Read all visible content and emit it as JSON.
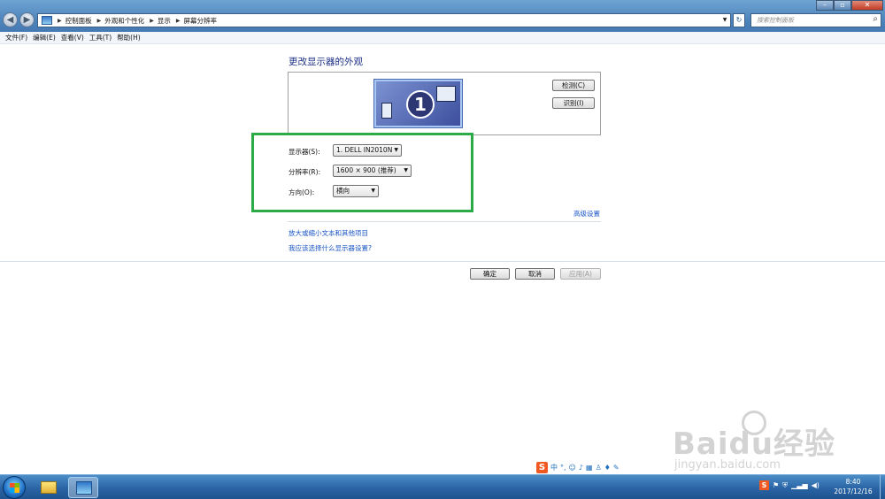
{
  "address_bar": {
    "breadcrumbs": [
      "控制面板",
      "外观和个性化",
      "显示",
      "屏幕分辨率"
    ]
  },
  "search": {
    "placeholder": "搜索控制面板"
  },
  "menu": [
    "文件(F)",
    "编辑(E)",
    "查看(V)",
    "工具(T)",
    "帮助(H)"
  ],
  "main": {
    "heading": "更改显示器的外观",
    "monitor_number": "1",
    "detect_button": "检测(C)",
    "identify_button": "识别(I)",
    "fields": {
      "display_label": "显示器(S):",
      "display_value": "1. DELL IN2010N",
      "resolution_label": "分辨率(R):",
      "resolution_value": "1600 × 900 (推荐)",
      "orientation_label": "方向(O):",
      "orientation_value": "横向"
    },
    "advanced_link": "高级设置",
    "links": [
      "放大或缩小文本和其他项目",
      "我应该选择什么显示器设置?"
    ],
    "buttons": {
      "ok": "确定",
      "cancel": "取消",
      "apply": "应用(A)"
    },
    "highlight_color": "#2bab48"
  },
  "language_bar": {
    "ime_logo": "S",
    "mode": "中"
  },
  "taskbar": {
    "time": "8:40",
    "date": "2017/12/16"
  },
  "watermark": {
    "brand": "Baidu经验",
    "url": "jingyan.baidu.com"
  }
}
